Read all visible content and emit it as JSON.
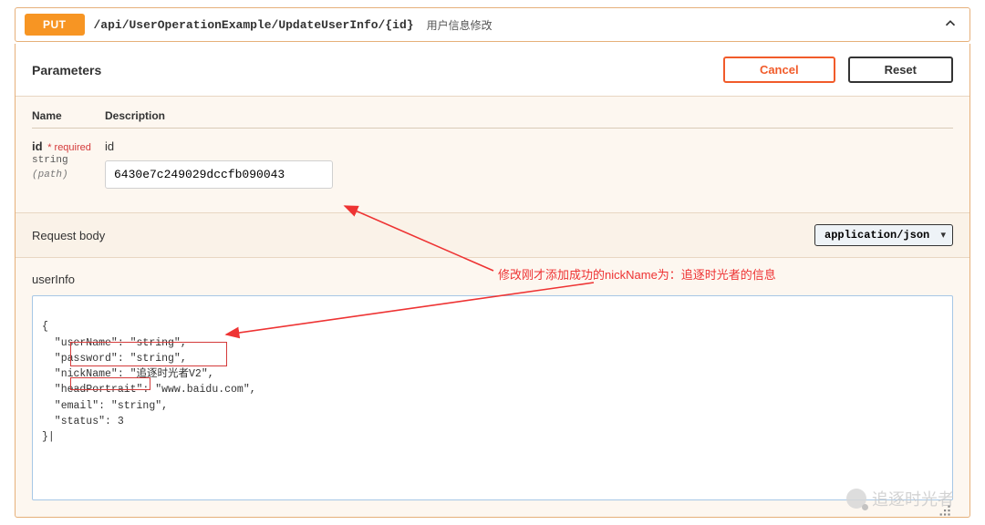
{
  "operation": {
    "method": "PUT",
    "path": "/api/UserOperationExample/UpdateUserInfo/{id}",
    "summary": "用户信息修改"
  },
  "actions": {
    "cancel": "Cancel",
    "reset": "Reset"
  },
  "params": {
    "heading": "Parameters",
    "name_header": "Name",
    "desc_header": "Description",
    "items": [
      {
        "name": "id",
        "required_label": "* required",
        "type": "string",
        "in": "(path)",
        "description": "id",
        "value": "6430e7c249029dccfb090043"
      }
    ]
  },
  "request_body": {
    "label": "Request body",
    "content_type": "application/json",
    "field_label": "userInfo",
    "body_lines": [
      "{",
      "  \"userName\": \"string\",",
      "  \"password\": \"string\",",
      "  \"nickName\": \"追逐时光者V2\",",
      "  \"headPortrait\": \"www.baidu.com\",",
      "  \"email\": \"string\",",
      "  \"status\": 3",
      "}|"
    ]
  },
  "annotation": {
    "text": "修改刚才添加成功的nickName为：追逐时光者的信息"
  },
  "watermark": {
    "text": "追逐时光者"
  }
}
